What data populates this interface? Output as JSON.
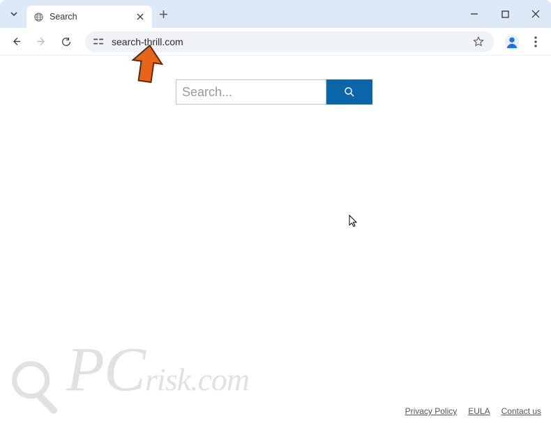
{
  "browser": {
    "tab_title": "Search",
    "url": "search-thrill.com"
  },
  "page": {
    "search_placeholder": "Search..."
  },
  "footer": {
    "privacy": "Privacy Policy",
    "eula": "EULA",
    "contact": "Contact us"
  },
  "watermark": {
    "prefix": "PC",
    "suffix": "risk.com"
  }
}
